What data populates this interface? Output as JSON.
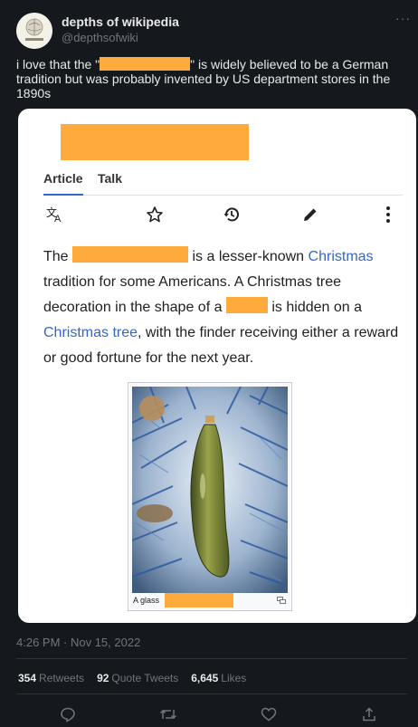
{
  "tweet": {
    "display_name": "depths of wikipedia",
    "handle": "@depthsofwiki",
    "text_before": "i love that the \"",
    "text_after": "\" is widely believed to be a German tradition but was probably invented by US department stores in the 1890s",
    "timestamp": "4:26 PM · Nov 15, 2022",
    "retweets_count": "354",
    "retweets_label": "Retweets",
    "quotes_count": "92",
    "quotes_label": "Quote Tweets",
    "likes_count": "6,645",
    "likes_label": "Likes"
  },
  "article": {
    "tabs": [
      "Article",
      "Talk"
    ],
    "p1_the": "The",
    "p1_mid": " is a lesser-known ",
    "p1_link1": "Christmas",
    "p1_rest1": " tradition for some Americans. A Christmas tree decoration in the shape of a ",
    "p1_rest2": " is hidden on a ",
    "p1_link2": "Christmas tree",
    "p1_rest3": ", with the finder receiving either a reward or good fortune for the next year.",
    "caption": "A glass"
  },
  "colors": {
    "redaction": "#ffaa3d",
    "link": "#3366cc",
    "tweet_bg": "#15181c"
  },
  "icons": [
    "language-icon",
    "star-icon",
    "history-icon",
    "edit-icon",
    "more-vertical-icon",
    "reply-icon",
    "retweet-icon",
    "like-icon",
    "share-icon"
  ]
}
